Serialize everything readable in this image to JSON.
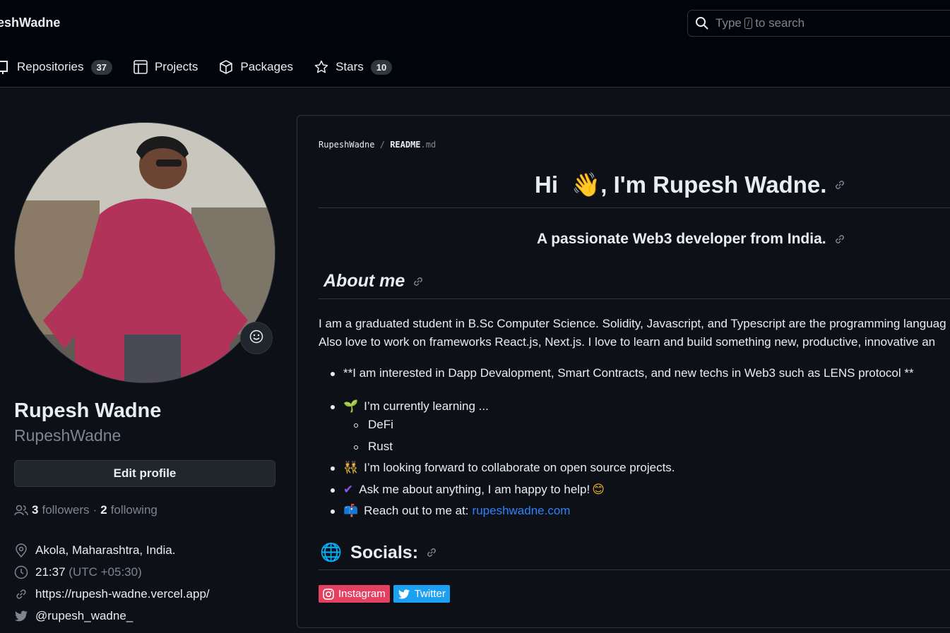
{
  "header": {
    "brand": "eshWadne",
    "search": {
      "pre": "Type",
      "key": "/",
      "post": "to search"
    }
  },
  "tabs": [
    {
      "label": "Repositories",
      "count": "37",
      "icon": "repo-icon"
    },
    {
      "label": "Projects",
      "icon": "table-icon"
    },
    {
      "label": "Packages",
      "icon": "package-icon"
    },
    {
      "label": "Stars",
      "count": "10",
      "icon": "star-icon"
    }
  ],
  "profile": {
    "name": "Rupesh Wadne",
    "login": "RupeshWadne",
    "edit_label": "Edit profile",
    "followers_count": "3",
    "followers_label": "followers",
    "sep": "·",
    "following_count": "2",
    "following_label": "following",
    "location": "Akola, Maharashtra, India.",
    "time": "21:37",
    "timezone": "(UTC +05:30)",
    "website": "https://rupesh-wadne.vercel.app/",
    "twitter": "@rupesh_wadne_"
  },
  "readme": {
    "owner": "RupeshWadne",
    "slash": "/",
    "file": "README",
    "ext": ".md",
    "h1_pre": "Hi ",
    "h1_emoji": "👋",
    "h1_post": ", I'm Rupesh Wadne.",
    "subtitle": "A passionate Web3 developer from India.",
    "about_title": "About me",
    "para_line1": "I am a graduated student in B.Sc Computer Science. Solidity, Javascript, and Typescript are the programming languag",
    "para_line2": "Also love to work on frameworks React.js, Next.js. I love to learn and build something new, productive, innovative an",
    "bullet1": "**I am interested in Dapp Devalopment, Smart Contracts, and new techs in Web3 such as LENS protocol **",
    "bullet2_emoji": "🌱",
    "bullet2": "I’m currently learning ...",
    "sub1": "DeFi",
    "sub2": "Rust",
    "bullet3_emoji": "👯",
    "bullet3": "I’m looking forward to collaborate on open source projects.",
    "bullet4_emoji": "✔",
    "bullet4": "Ask me about anything, I am happy to help!",
    "bullet4_end": "😊",
    "bullet5_emoji": "📫",
    "bullet5_pre": "Reach out to me at:",
    "bullet5_link": "rupeshwadne.com",
    "socials_emoji": "🌐",
    "socials_title": "Socials:",
    "badge_instagram": "Instagram",
    "badge_twitter": "Twitter"
  },
  "colors": {
    "accent": "#2f81f7",
    "instagram": "#e4405f",
    "twitter": "#1ca0f2",
    "bg": "#0d1117"
  }
}
